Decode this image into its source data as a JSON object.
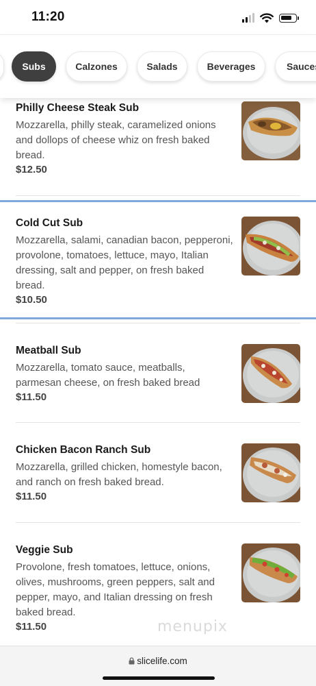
{
  "status_bar": {
    "time": "11:20",
    "battery_level": 0.8
  },
  "categories": [
    {
      "label": "",
      "active": false
    },
    {
      "label": "Subs",
      "active": true
    },
    {
      "label": "Calzones",
      "active": false
    },
    {
      "label": "Salads",
      "active": false
    },
    {
      "label": "Beverages",
      "active": false
    },
    {
      "label": "Sauces",
      "active": false
    }
  ],
  "menu_items": [
    {
      "name": "Philly Cheese Steak Sub",
      "description": "Mozzarella, philly steak, caramelized onions and dollops of cheese whiz on fresh baked bread.",
      "price": "$12.50"
    },
    {
      "name": "Cold Cut Sub",
      "description": "Mozzarella, salami, canadian bacon, pepperoni, provolone, tomatoes, lettuce, mayo, Italian dressing, salt and pepper, on fresh baked bread.",
      "price": "$10.50"
    },
    {
      "name": "Meatball Sub",
      "description": "Mozzarella, tomato sauce, meatballs, parmesan cheese, on fresh baked bread",
      "price": "$11.50"
    },
    {
      "name": "Chicken Bacon Ranch Sub",
      "description": "Mozzarella, grilled chicken, homestyle bacon, and ranch on fresh baked bread.",
      "price": "$11.50"
    },
    {
      "name": "Veggie Sub",
      "description": "Provolone, fresh tomatoes, lettuce, onions, olives, mushrooms, green peppers, salt and pepper, mayo, and Italian dressing on fresh baked bread.",
      "price": "$11.50"
    }
  ],
  "watermark": "menupix",
  "browser": {
    "url": "slicelife.com"
  },
  "colors": {
    "active_pill": "#3f3f3f",
    "highlight_border": "#7fa7d9"
  }
}
